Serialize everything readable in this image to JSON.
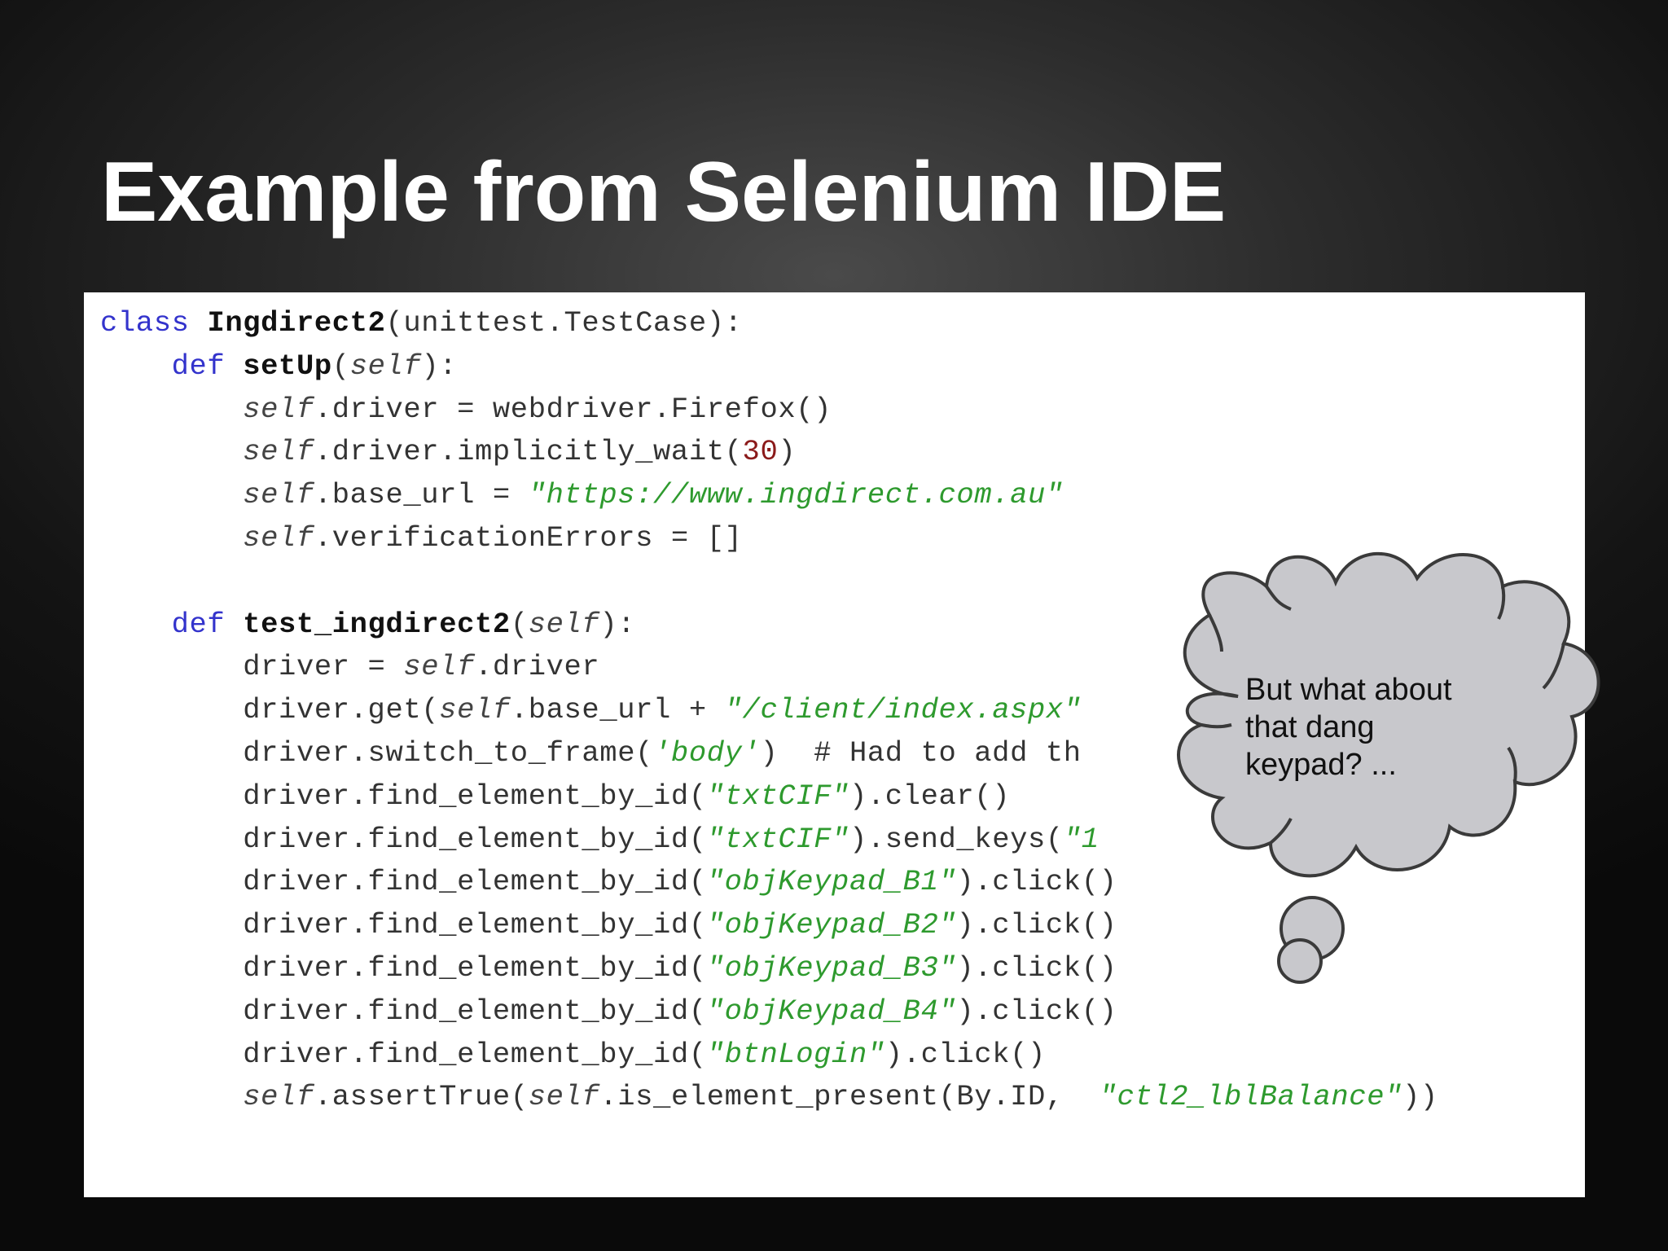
{
  "slide": {
    "title": "Example from Selenium IDE"
  },
  "code": {
    "line1": {
      "kw": "class",
      "name": "Ingdirect2",
      "rest": "(unittest.TestCase):"
    },
    "line2": {
      "kw": "def",
      "name": "setUp",
      "open": "(",
      "self": "self",
      "close": "):"
    },
    "line3": {
      "self": "self",
      "rest": ".driver = webdriver.Firefox()"
    },
    "line4": {
      "self": "self",
      "rest": ".driver.implicitly_wait(",
      "num": "30",
      "close": ")"
    },
    "line5": {
      "self": "self",
      "rest": ".base_url = ",
      "str": "\"https://www.ingdirect.com.au\""
    },
    "line6": {
      "self": "self",
      "rest": ".verificationErrors = []"
    },
    "line8": {
      "kw": "def",
      "name": "test_ingdirect2",
      "open": "(",
      "self": "self",
      "close": "):"
    },
    "line9": {
      "rest": "driver = ",
      "self": "self",
      "tail": ".driver"
    },
    "line10": {
      "rest": "driver.get(",
      "self": "self",
      "mid": ".base_url + ",
      "str": "\"/client/index.aspx\""
    },
    "line11": {
      "rest": "driver.switch_to_frame(",
      "str": "'body'",
      "close": ")",
      "cmt": "  # Had to add th"
    },
    "line12": {
      "rest": "driver.find_element_by_id(",
      "str": "\"txtCIF\"",
      "close": ").clear()"
    },
    "line13": {
      "rest": "driver.find_element_by_id(",
      "str": "\"txtCIF\"",
      "close": ").send_keys(",
      "str2": "\"1"
    },
    "line14": {
      "rest": "driver.find_element_by_id(",
      "str": "\"objKeypad_B1\"",
      "close": ").click()"
    },
    "line15": {
      "rest": "driver.find_element_by_id(",
      "str": "\"objKeypad_B2\"",
      "close": ").click()"
    },
    "line16": {
      "rest": "driver.find_element_by_id(",
      "str": "\"objKeypad_B3\"",
      "close": ").click()"
    },
    "line17": {
      "rest": "driver.find_element_by_id(",
      "str": "\"objKeypad_B4\"",
      "close": ").click()"
    },
    "line18": {
      "rest": "driver.find_element_by_id(",
      "str": "\"btnLogin\"",
      "close": ").click()"
    },
    "line19": {
      "self": "self",
      "rest": ".assertTrue(",
      "self2": "self",
      "mid": ".is_element_present(By.ID, ",
      "str": "\"ctl2_lblBalance\"",
      "close": "))"
    }
  },
  "callout": {
    "line1": "But what about",
    "line2": "that dang",
    "line3": "keypad? ..."
  },
  "colors": {
    "keyword": "#3333cc",
    "string": "#2e9a2e",
    "number": "#8b1a1a",
    "cloud_fill": "#c8c8cc",
    "cloud_stroke": "#3a3a3a"
  }
}
